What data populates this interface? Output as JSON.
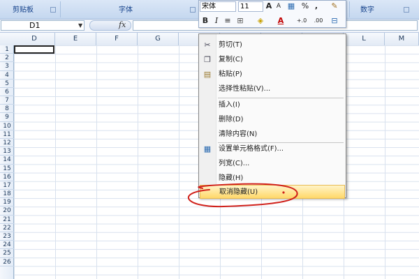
{
  "ribbon": {
    "groups": [
      "剪贴板",
      "字体",
      "数字"
    ]
  },
  "formula_bar": {
    "name_box": "D1",
    "fx_label": "fx",
    "formula_value": ""
  },
  "grid": {
    "columns": [
      "D",
      "E",
      "F",
      "G",
      "",
      "",
      "",
      "",
      "L",
      "M"
    ],
    "rows": [
      "1",
      "2",
      "3",
      "4",
      "5",
      "6",
      "7",
      "8",
      "9",
      "10",
      "11",
      "12",
      "13",
      "14",
      "15",
      "16",
      "17",
      "18",
      "19",
      "20",
      "21",
      "22",
      "23",
      "24",
      "25",
      "26"
    ]
  },
  "mini_toolbar": {
    "font_name": "宋体",
    "font_size": "11",
    "grow_font": "A",
    "shrink_font": "A",
    "percent": "%",
    "comma": ",",
    "bold": "B",
    "italic": "I",
    "align_center": "≡",
    "font_color": "A",
    "dec_increase": "+.0",
    "dec_decrease": ".00"
  },
  "context_menu": {
    "items": [
      {
        "label": "剪切(T)",
        "icon": "scissors-icon"
      },
      {
        "label": "复制(C)",
        "icon": "copy-icon"
      },
      {
        "label": "粘贴(P)",
        "icon": "paste-icon"
      },
      {
        "label": "选择性粘贴(V)...",
        "icon": ""
      },
      {
        "label": "插入(I)",
        "icon": ""
      },
      {
        "label": "删除(D)",
        "icon": ""
      },
      {
        "label": "清除内容(N)",
        "icon": ""
      },
      {
        "label": "设置单元格格式(F)...",
        "icon": "format-cells-icon"
      },
      {
        "label": "列宽(C)...",
        "icon": ""
      },
      {
        "label": "隐藏(H)",
        "icon": ""
      },
      {
        "label": "取消隐藏(U)",
        "icon": ""
      }
    ],
    "highlighted_index": 10,
    "annotation_color": "#d0201a",
    "highlight_color": "#ffd86a"
  }
}
